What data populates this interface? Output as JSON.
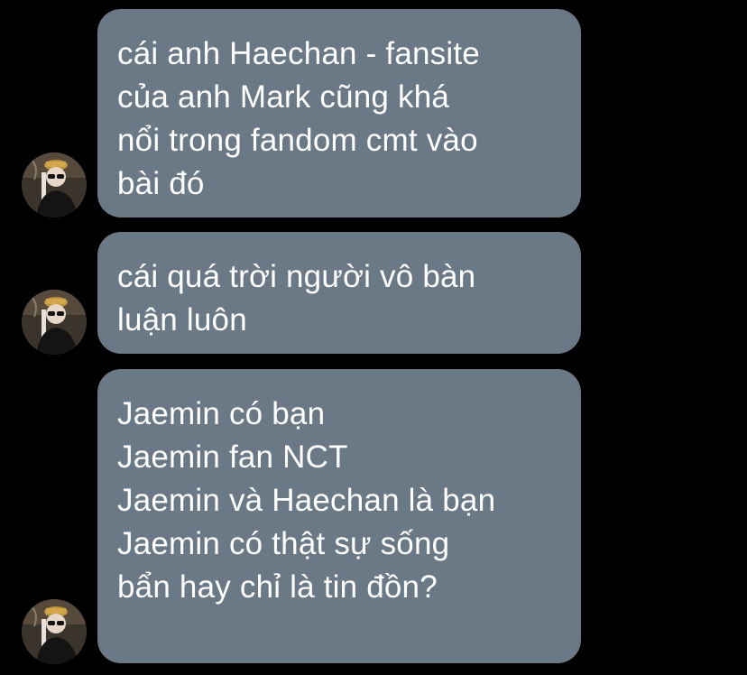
{
  "conversation": {
    "messages": [
      {
        "lines": [
          "cái anh Haechan - fansite",
          "của anh Mark cũng khá",
          "nổi trong fandom cmt vào",
          "bài đó"
        ]
      },
      {
        "lines": [
          "cái quá trời người vô bàn",
          "luận luôn"
        ]
      },
      {
        "lines": [
          "Jaemin có bạn",
          "Jaemin fan NCT",
          "Jaemin và Haechan là bạn",
          "Jaemin có thật sự sống",
          "bẩn hay chỉ là tin đồn?"
        ]
      }
    ]
  },
  "theme": {
    "background": "#000000",
    "bubble_color": "#6b7886",
    "text_color": "#ffffff"
  },
  "icons": {
    "avatar": "sender-avatar-photo"
  }
}
